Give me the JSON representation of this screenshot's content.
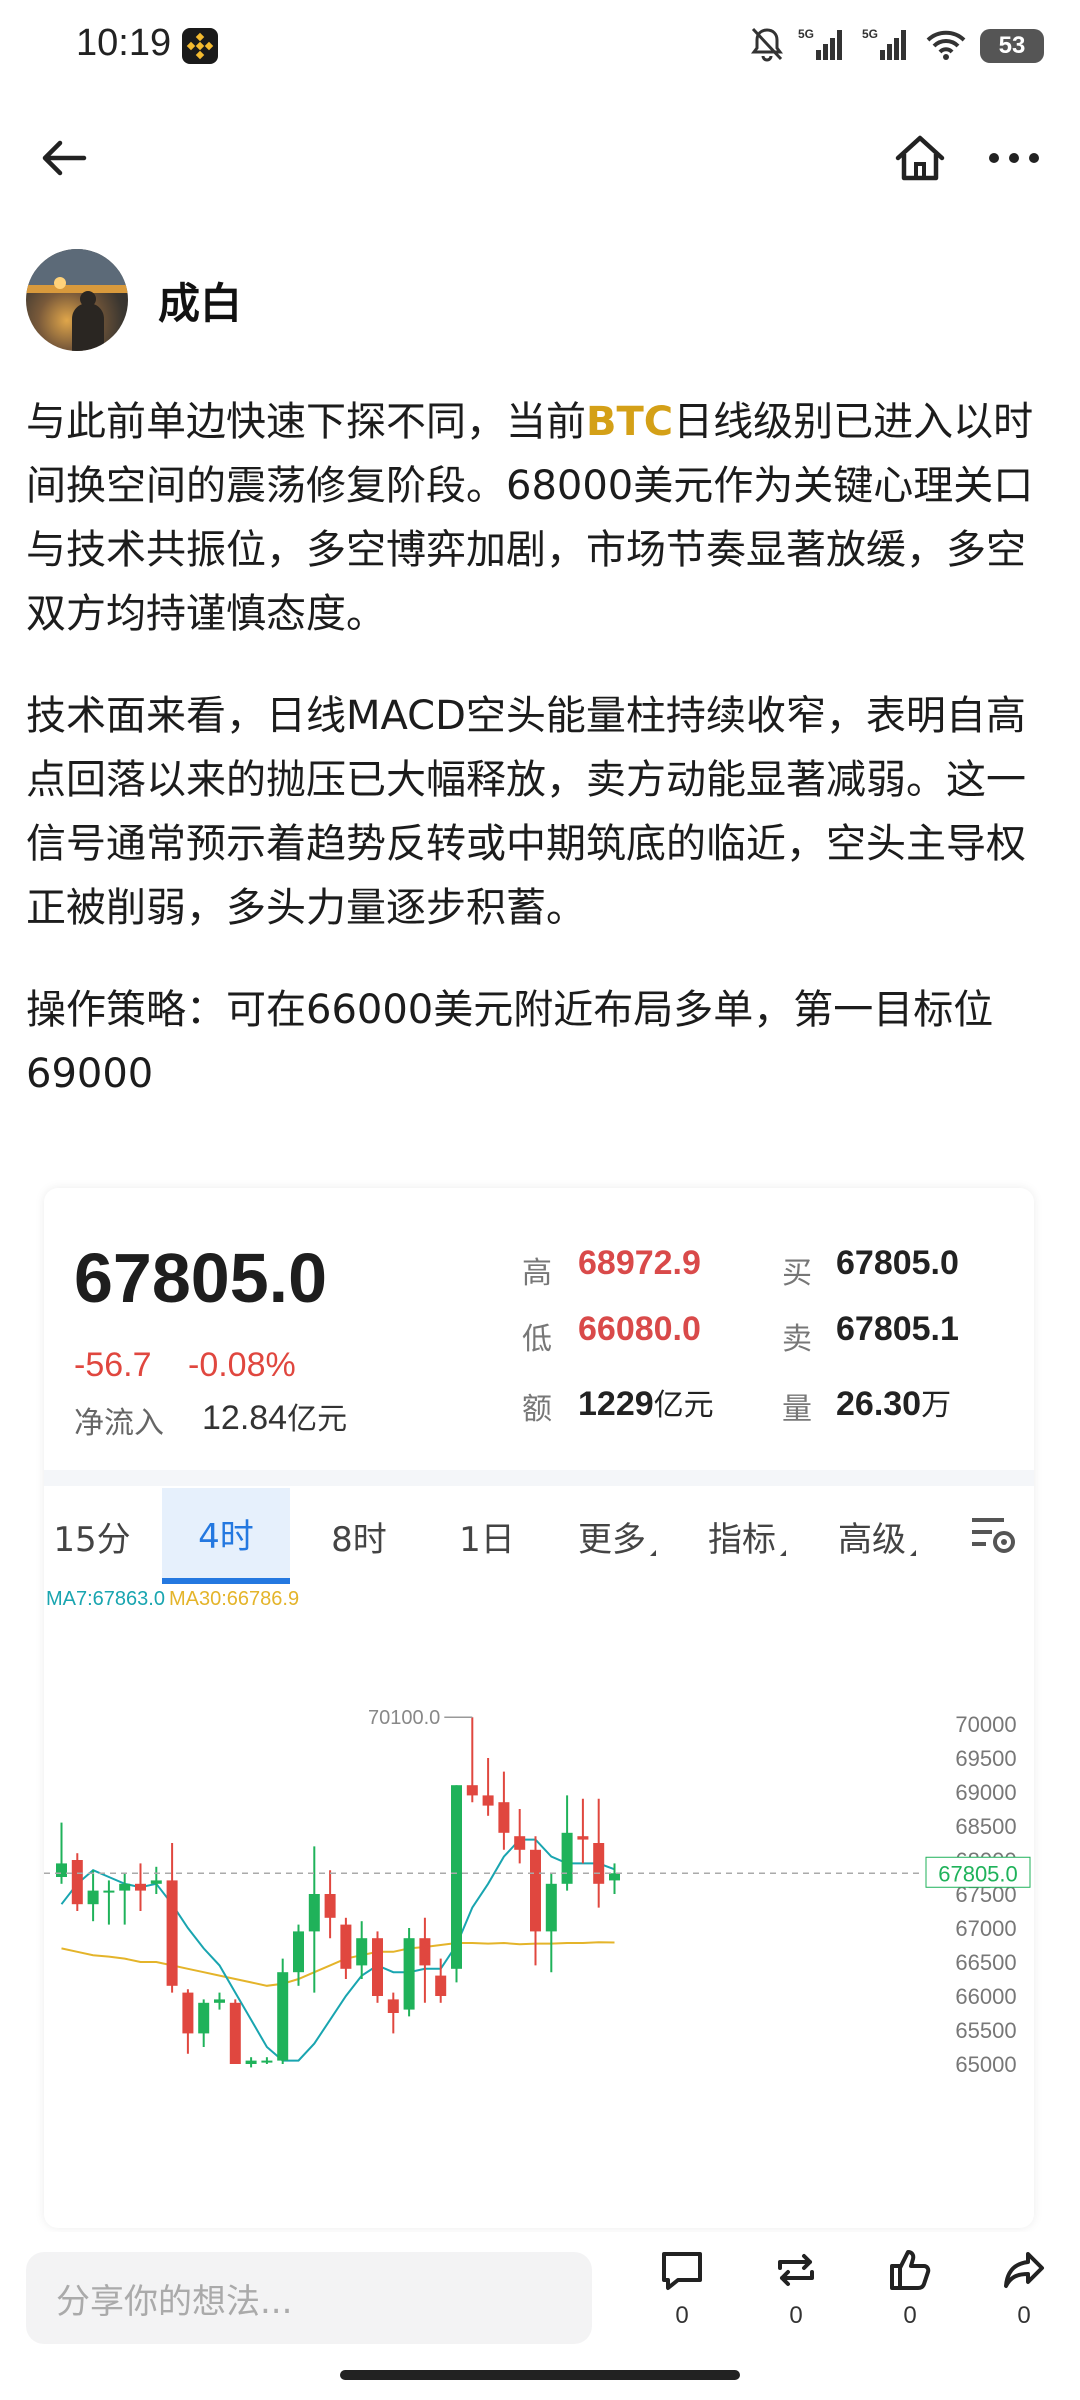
{
  "status_bar": {
    "time": "10:19",
    "app_icon": "binance-logo-icon",
    "icons": [
      "mute-bell-icon",
      "signal-5g-icon",
      "signal-5g-icon",
      "wifi-icon"
    ],
    "network_label": "5G",
    "battery": "53"
  },
  "nav": {
    "back_icon": "back-arrow-icon",
    "home_icon": "home-icon",
    "more_icon": "more-dots-icon"
  },
  "author": {
    "name": "成白"
  },
  "post": {
    "p1_a": "与此前单边快速下探不同，当前",
    "p1_highlight": "BTC",
    "p1_b": "日线级别已进入以时间换空间的震荡修复阶段。68000美元作为关键心理关口与技术共振位，多空博弈加剧，市场节奏显著放缓，多空双方均持谨慎态度。",
    "p2": "技术面来看，日线MACD空头能量柱持续收窄，表明自高点回落以来的抛压已大幅释放，卖方动能显著减弱。这一信号通常预示着趋势反转或中期筑底的临近，空头主导权正被削弱，多头力量逐步积蓄。",
    "p3": "操作策略：可在66000美元附近布局多单，第一目标位69000",
    "highlight_color": "#d4a017"
  },
  "ticker": {
    "price": "67805.0",
    "change_abs": "-56.7",
    "change_pct": "-0.08%",
    "net_inflow_label": "净流入",
    "net_inflow_value": "12.84",
    "net_inflow_unit": "亿元",
    "high_label": "高",
    "high_value": "68972.9",
    "low_label": "低",
    "low_value": "66080.0",
    "amount_label": "额",
    "amount_value": "1229",
    "amount_unit": "亿元",
    "buy_label": "买",
    "buy_value": "67805.0",
    "sell_label": "卖",
    "sell_value": "67805.1",
    "volume_label": "量",
    "volume_value": "26.30",
    "volume_unit": "万",
    "up_color": "#1fb25a",
    "down_color": "#e0473f"
  },
  "tabs": {
    "items": [
      "15分",
      "4时",
      "8时",
      "1日",
      "更多",
      "指标",
      "高级"
    ],
    "active": "4时",
    "settings_icon": "chart-settings-icon"
  },
  "legend": {
    "ma7": "MA7:67863.0",
    "ma30": "MA30:66786.9",
    "ma7_color": "#19a5b0",
    "ma30_color": "#e4b42a"
  },
  "chart_data": {
    "type": "candlestick",
    "y_ticks": [
      "70000",
      "69500",
      "69000",
      "68500",
      "68000",
      "67500",
      "67000",
      "66500",
      "66000",
      "65500",
      "65000"
    ],
    "ylim": [
      65000,
      70000
    ],
    "high_marker": "70100.0",
    "current_price_label": "67805.0",
    "current_price": 67805,
    "candles": [
      {
        "o": 67750,
        "c": 67950,
        "h": 68550,
        "l": 67650
      },
      {
        "o": 68000,
        "c": 67350,
        "h": 68100,
        "l": 67250
      },
      {
        "o": 67350,
        "c": 67550,
        "h": 67850,
        "l": 67100
      },
      {
        "o": 67550,
        "c": 67550,
        "h": 67700,
        "l": 67050
      },
      {
        "o": 67550,
        "c": 67650,
        "h": 67800,
        "l": 67050
      },
      {
        "o": 67650,
        "c": 67550,
        "h": 67950,
        "l": 67250
      },
      {
        "o": 67650,
        "c": 67700,
        "h": 67900,
        "l": 67500
      },
      {
        "o": 67700,
        "c": 66150,
        "h": 68250,
        "l": 66050
      },
      {
        "o": 66050,
        "c": 65450,
        "h": 66100,
        "l": 65150
      },
      {
        "o": 65450,
        "c": 65900,
        "h": 65950,
        "l": 65250
      },
      {
        "o": 65900,
        "c": 65950,
        "h": 66050,
        "l": 65800
      },
      {
        "o": 65900,
        "c": 65000,
        "h": 65950,
        "l": 65000
      },
      {
        "o": 65000,
        "c": 65050,
        "h": 65100,
        "l": 64950
      },
      {
        "o": 65050,
        "c": 65050,
        "h": 65100,
        "l": 65000
      },
      {
        "o": 65050,
        "c": 66350,
        "h": 66550,
        "l": 65000
      },
      {
        "o": 66350,
        "c": 66950,
        "h": 67050,
        "l": 66150
      },
      {
        "o": 66950,
        "c": 67500,
        "h": 68200,
        "l": 66050
      },
      {
        "o": 67500,
        "c": 67150,
        "h": 67850,
        "l": 66850
      },
      {
        "o": 67050,
        "c": 66400,
        "h": 67150,
        "l": 66250
      },
      {
        "o": 66450,
        "c": 66850,
        "h": 67100,
        "l": 66250
      },
      {
        "o": 66850,
        "c": 66000,
        "h": 66950,
        "l": 65900
      },
      {
        "o": 65950,
        "c": 65750,
        "h": 66050,
        "l": 65450
      },
      {
        "o": 65800,
        "c": 66850,
        "h": 67000,
        "l": 65700
      },
      {
        "o": 66850,
        "c": 66450,
        "h": 67150,
        "l": 65900
      },
      {
        "o": 66300,
        "c": 66000,
        "h": 66550,
        "l": 65900
      },
      {
        "o": 66400,
        "c": 69100,
        "h": 69100,
        "l": 66200
      },
      {
        "o": 69100,
        "c": 68950,
        "h": 70100,
        "l": 68850
      },
      {
        "o": 68950,
        "c": 68800,
        "h": 69500,
        "l": 68650
      },
      {
        "o": 68850,
        "c": 68400,
        "h": 69300,
        "l": 68150
      },
      {
        "o": 68350,
        "c": 68150,
        "h": 68750,
        "l": 67950
      },
      {
        "o": 68150,
        "c": 66950,
        "h": 68350,
        "l": 66450
      },
      {
        "o": 66950,
        "c": 67650,
        "h": 67800,
        "l": 66350
      },
      {
        "o": 67650,
        "c": 68400,
        "h": 68950,
        "l": 67550
      },
      {
        "o": 68350,
        "c": 68300,
        "h": 68900,
        "l": 67950
      },
      {
        "o": 68250,
        "c": 67650,
        "h": 68900,
        "l": 67300
      },
      {
        "o": 67700,
        "c": 67805,
        "h": 67950,
        "l": 67500
      }
    ],
    "ma7": [
      67350,
      67650,
      67850,
      67750,
      67650,
      67600,
      67650,
      67350,
      67000,
      66700,
      66450,
      66050,
      65650,
      65250,
      65050,
      65050,
      65300,
      65650,
      66000,
      66300,
      66450,
      66350,
      66350,
      66400,
      66400,
      66750,
      67300,
      67650,
      68050,
      68300,
      68300,
      68050,
      67950,
      67950,
      67950,
      67863
    ],
    "ma30": [
      66700,
      66650,
      66600,
      66580,
      66550,
      66500,
      66500,
      66450,
      66400,
      66350,
      66300,
      66250,
      66200,
      66150,
      66180,
      66250,
      66350,
      66450,
      66550,
      66600,
      66650,
      66650,
      66700,
      66720,
      66750,
      66780,
      66780,
      66770,
      66780,
      66760,
      66770,
      66770,
      66780,
      66780,
      66790,
      66787
    ]
  },
  "comment_bar": {
    "placeholder": "分享你的想法...",
    "actions": [
      {
        "icon": "comment-icon",
        "count": "0"
      },
      {
        "icon": "repost-icon",
        "count": "0"
      },
      {
        "icon": "like-icon",
        "count": "0"
      },
      {
        "icon": "share-icon",
        "count": "0"
      }
    ]
  }
}
